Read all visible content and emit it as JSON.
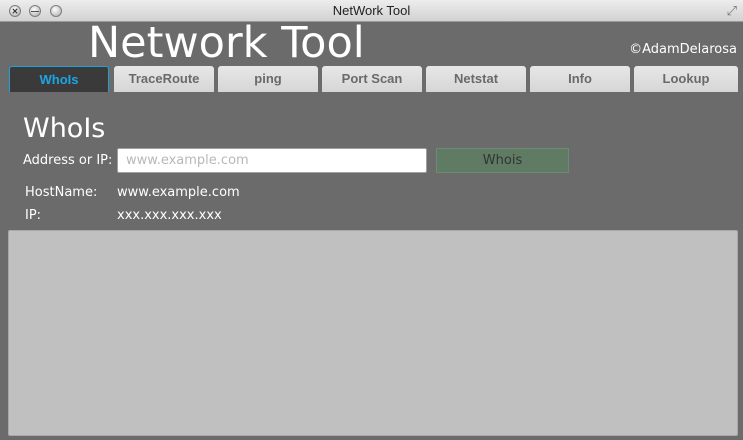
{
  "window": {
    "title": "NetWork Tool",
    "close_glyph": "✕",
    "minimize_glyph": "—",
    "resize_glyph": "⤢"
  },
  "header": {
    "app_title": "Network Tool",
    "copyright": "©AdamDelarosa"
  },
  "tabs": [
    {
      "label": "WhoIs",
      "active": true
    },
    {
      "label": "TraceRoute",
      "active": false
    },
    {
      "label": "ping",
      "active": false
    },
    {
      "label": "Port Scan",
      "active": false
    },
    {
      "label": "Netstat",
      "active": false
    },
    {
      "label": "Info",
      "active": false
    },
    {
      "label": "Lookup",
      "active": false
    }
  ],
  "whois": {
    "title": "WhoIs",
    "address_label": "Address or IP:",
    "address_placeholder": "www.example.com",
    "address_value": "",
    "button_label": "Whois",
    "hostname_label": "HostName:",
    "hostname_value": "www.example.com",
    "ip_label": "IP:",
    "ip_value": "xxx.xxx.xxx.xxx",
    "output": ""
  },
  "colors": {
    "background": "#6b6b6b",
    "active_tab_text": "#1ca5e6",
    "button_bg": "#5f7b63",
    "output_bg": "#c0c0c0"
  }
}
